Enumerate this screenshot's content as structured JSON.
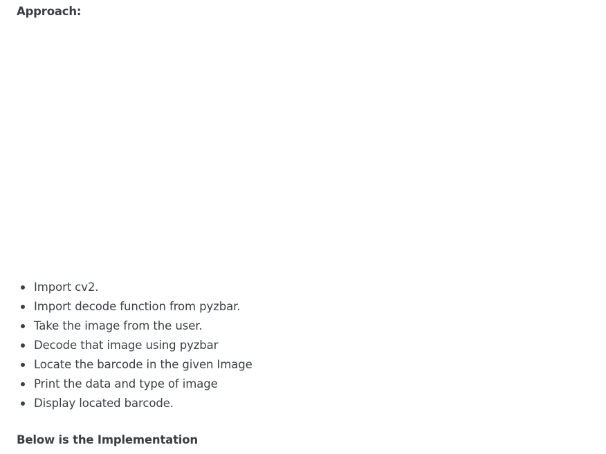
{
  "headings": {
    "approach": "Approach:",
    "implementation": "Below is the Implementation"
  },
  "steps": [
    "Import cv2.",
    "Import decode function from pyzbar.",
    "Take the image from the user.",
    "Decode that image using pyzbar",
    "Locate the barcode in the given Image",
    "Print the data and type of image",
    "Display located barcode."
  ]
}
